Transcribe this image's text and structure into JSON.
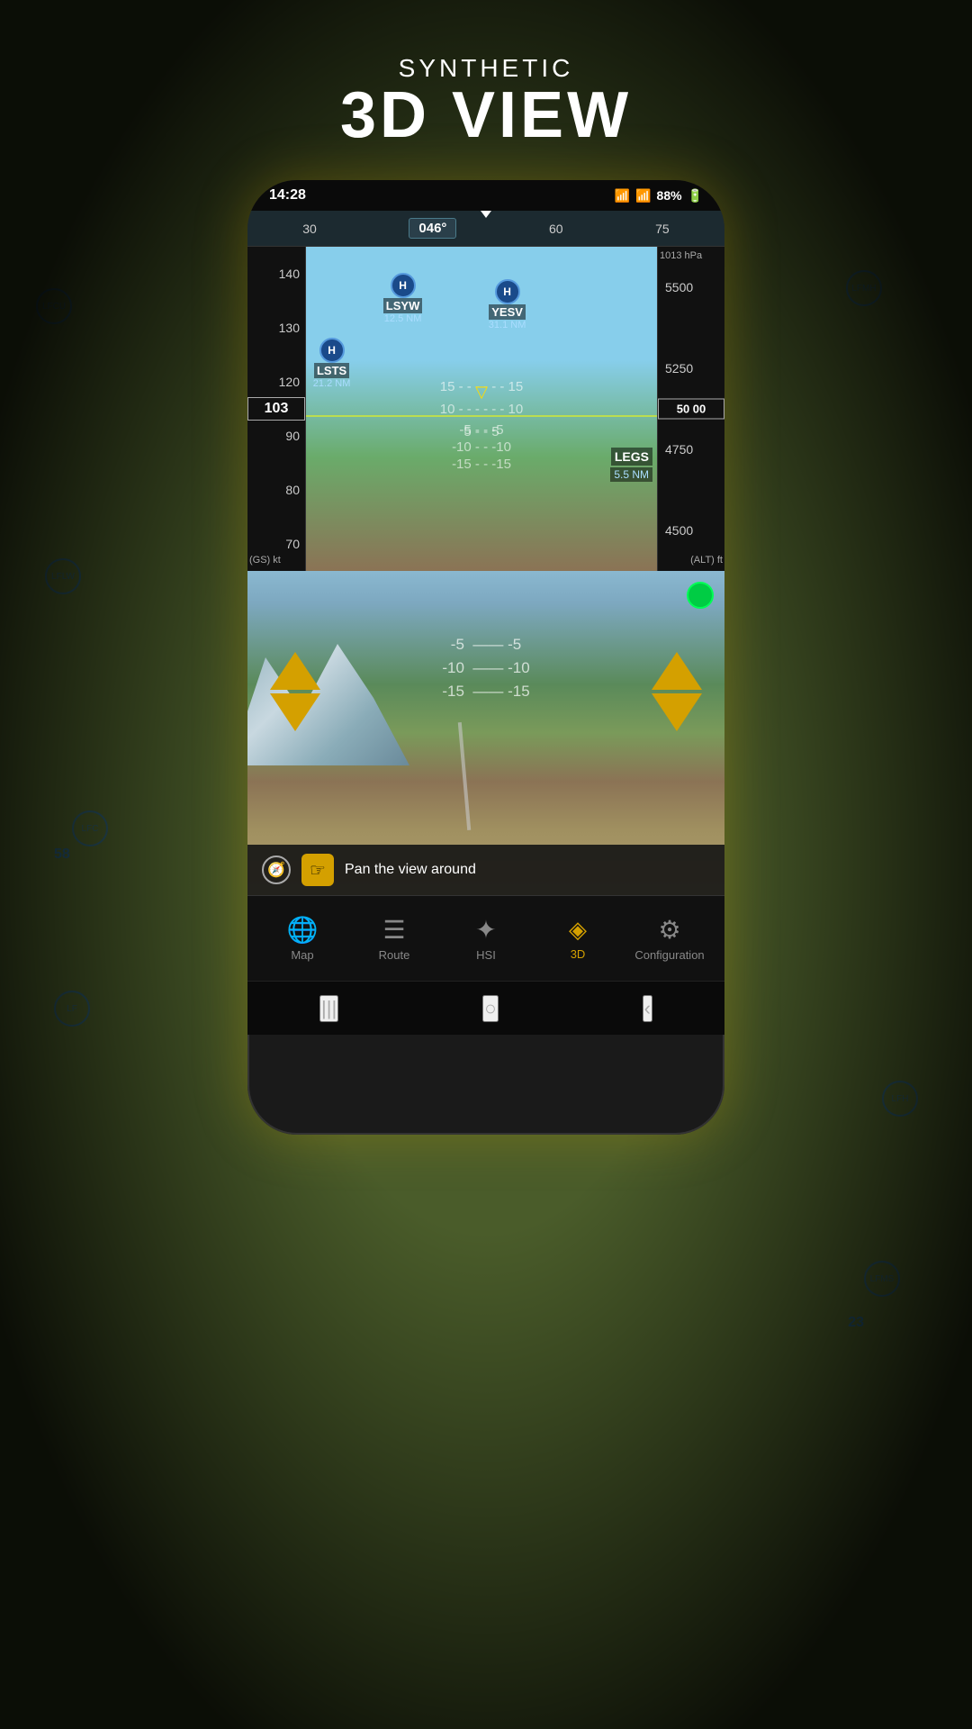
{
  "title": {
    "line1": "SYNTHETIC",
    "line2": "3D VIEW"
  },
  "status_bar": {
    "time": "14:28",
    "signal": "88%",
    "battery": "88%"
  },
  "compass": {
    "heading": "046°",
    "marks": [
      "30",
      "60",
      "75"
    ]
  },
  "speed_tape": {
    "values": [
      "140",
      "130",
      "120",
      "103",
      "90",
      "80",
      "70"
    ],
    "current": "103",
    "unit": "(GS) kt"
  },
  "altitude_tape": {
    "pressure": "1013 hPa",
    "values": [
      "5500",
      "5250",
      "5000",
      "4750",
      "4500"
    ],
    "current": "50 00",
    "unit": "(ALT) ft"
  },
  "pitch_lines": {
    "values": [
      "15",
      "10",
      "5",
      "-5",
      "-10",
      "-15"
    ]
  },
  "waypoints": [
    {
      "id": "H",
      "name": "LSYW",
      "dist": "12.5 NM",
      "top": "16%",
      "left": "18%"
    },
    {
      "id": "H",
      "name": "LSTS",
      "dist": "21.2 NM",
      "top": "26%",
      "left": "8%"
    },
    {
      "id": "H",
      "name": "YESV",
      "dist": "31.1 NM",
      "top": "18%",
      "left": "54%"
    },
    {
      "id": "H",
      "name": "LEGS",
      "dist": "5.5 NM",
      "top": "32%",
      "left": "68%"
    }
  ],
  "green_dot": {
    "color": "#00cc44"
  },
  "tooltip": {
    "text": "Pan the view around"
  },
  "nav_arrows": {
    "left": {
      "top": "22%",
      "left": "5%"
    },
    "right": {
      "top": "22%",
      "right": "5%"
    }
  },
  "bottom_nav": {
    "items": [
      {
        "id": "map",
        "label": "Map",
        "icon": "🌐",
        "active": false
      },
      {
        "id": "route",
        "label": "Route",
        "icon": "☰",
        "active": false
      },
      {
        "id": "hsi",
        "label": "HSI",
        "icon": "✦",
        "active": false
      },
      {
        "id": "3d",
        "label": "3D",
        "icon": "◈",
        "active": true
      },
      {
        "id": "config",
        "label": "Configuration",
        "icon": "⚙",
        "active": false
      }
    ]
  },
  "system_nav": {
    "buttons": [
      "|||",
      "○",
      "‹"
    ]
  }
}
